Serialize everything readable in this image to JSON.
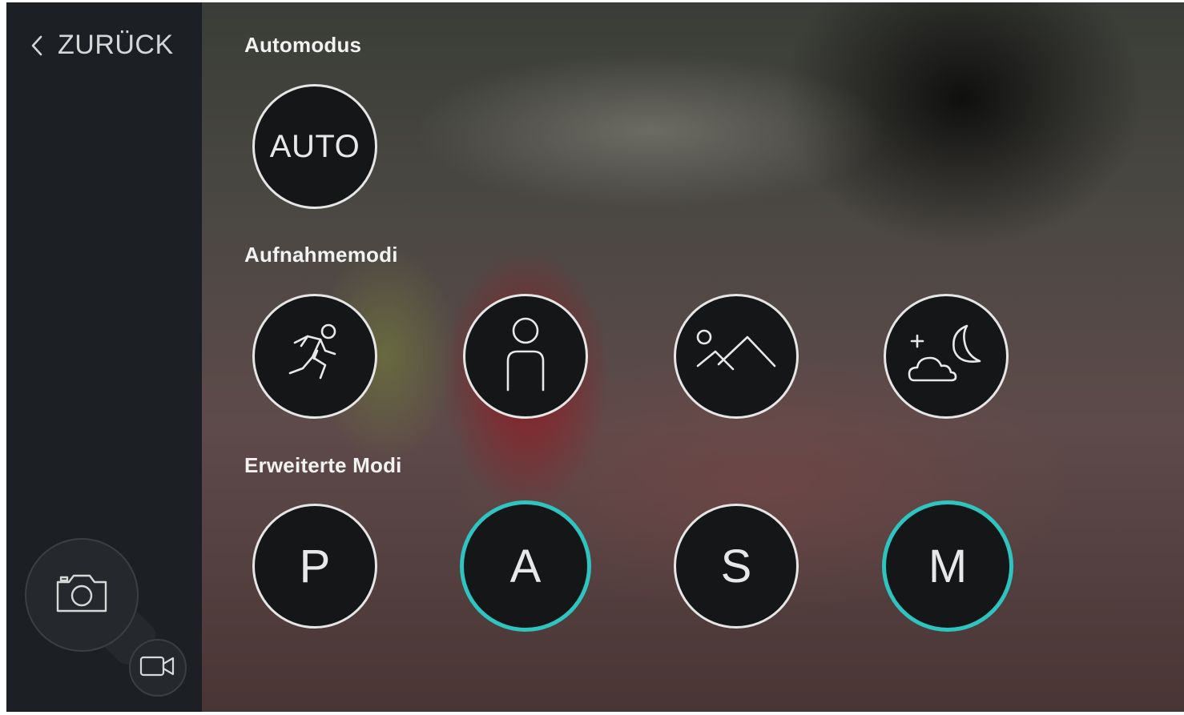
{
  "nav": {
    "back_label": "ZURÜCK"
  },
  "sections": {
    "auto_title": "Automodus",
    "scene_title": "Aufnahmemodi",
    "advanced_title": "Erweiterte Modi"
  },
  "auto_mode": {
    "label": "AUTO"
  },
  "scene_modes": [
    {
      "icon": "running-person-icon"
    },
    {
      "icon": "portrait-person-icon"
    },
    {
      "icon": "landscape-icon"
    },
    {
      "icon": "night-moon-cloud-icon"
    }
  ],
  "advanced_modes": [
    {
      "label": "P",
      "active": false
    },
    {
      "label": "A",
      "active": true
    },
    {
      "label": "S",
      "active": false
    },
    {
      "label": "M",
      "active": true
    }
  ],
  "colors": {
    "active_ring": "#2ec4c0",
    "sidebar": "#1c2024",
    "mode_fill": "#151617"
  },
  "capture": {
    "photo_icon": "camera-icon",
    "video_icon": "video-camera-icon"
  }
}
